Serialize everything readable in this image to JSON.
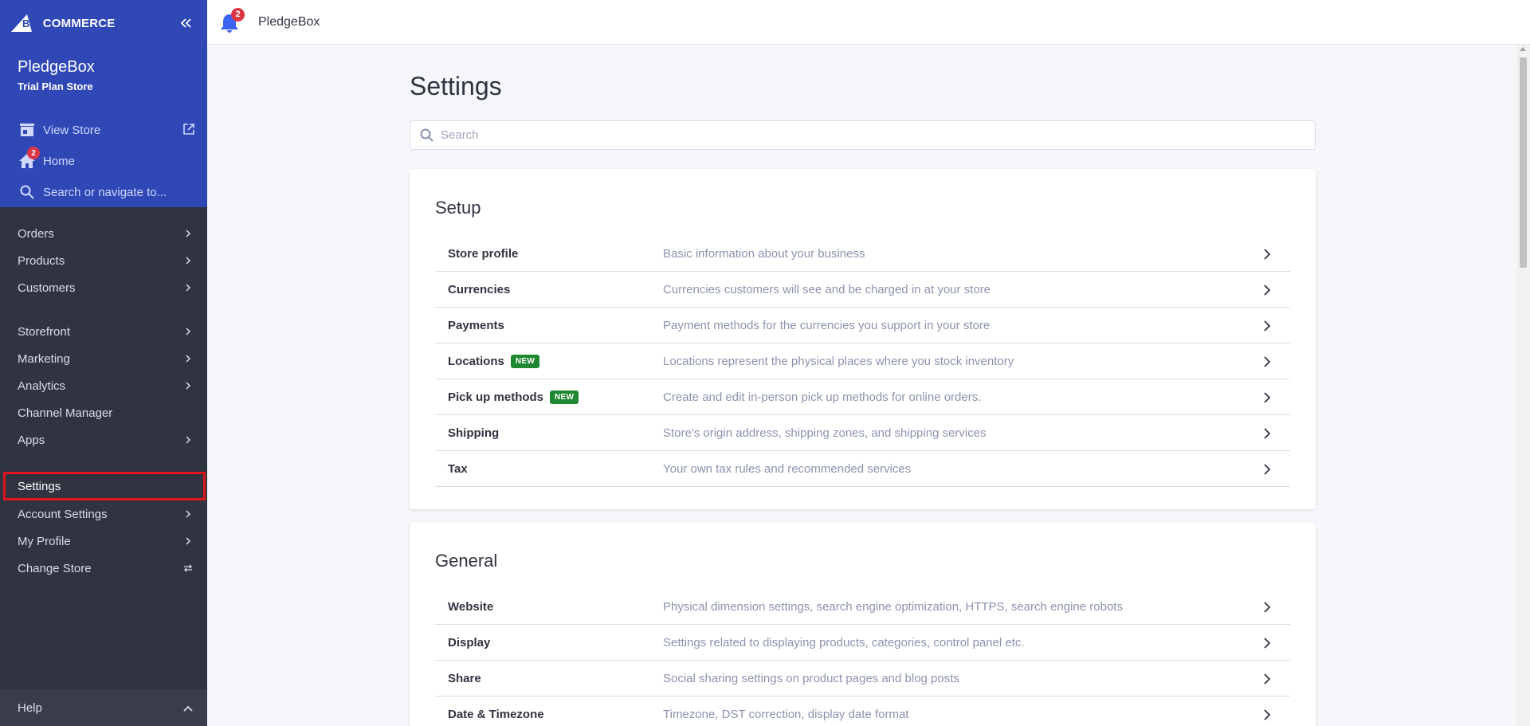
{
  "brand": {
    "logo_prefix": "BIG",
    "logo_suffix": "COMMERCE"
  },
  "store": {
    "name": "PledgeBox",
    "plan": "Trial Plan Store"
  },
  "sidebar_links": {
    "view_store": "View Store",
    "home": "Home",
    "home_badge": "2",
    "search": "Search or navigate to..."
  },
  "nav_group1": [
    {
      "label": "Orders",
      "chevron": true
    },
    {
      "label": "Products",
      "chevron": true
    },
    {
      "label": "Customers",
      "chevron": true
    }
  ],
  "nav_group2": [
    {
      "label": "Storefront",
      "chevron": true
    },
    {
      "label": "Marketing",
      "chevron": true
    },
    {
      "label": "Analytics",
      "chevron": true
    },
    {
      "label": "Channel Manager",
      "chevron": false
    },
    {
      "label": "Apps",
      "chevron": true
    }
  ],
  "nav_group3": [
    {
      "label": "Settings",
      "chevron": false,
      "active": true
    },
    {
      "label": "Account Settings",
      "chevron": true
    },
    {
      "label": "My Profile",
      "chevron": true
    },
    {
      "label": "Change Store",
      "swap": true
    }
  ],
  "help": {
    "label": "Help"
  },
  "topbar": {
    "title": "PledgeBox",
    "bell_badge": "2"
  },
  "page": {
    "title": "Settings",
    "search_placeholder": "Search"
  },
  "sections": {
    "setup": {
      "title": "Setup",
      "rows": [
        {
          "name": "Store profile",
          "desc": "Basic information about your business"
        },
        {
          "name": "Currencies",
          "desc": "Currencies customers will see and be charged in at your store"
        },
        {
          "name": "Payments",
          "desc": "Payment methods for the currencies you support in your store"
        },
        {
          "name": "Locations",
          "desc": "Locations represent the physical places where you stock inventory",
          "badge": "NEW"
        },
        {
          "name": "Pick up methods",
          "desc": "Create and edit in-person pick up methods for online orders.",
          "badge": "NEW"
        },
        {
          "name": "Shipping",
          "desc": "Store's origin address, shipping zones, and shipping services"
        },
        {
          "name": "Tax",
          "desc": "Your own tax rules and recommended services"
        }
      ]
    },
    "general": {
      "title": "General",
      "rows": [
        {
          "name": "Website",
          "desc": "Physical dimension settings, search engine optimization, HTTPS, search engine robots"
        },
        {
          "name": "Display",
          "desc": "Settings related to displaying products, categories, control panel etc."
        },
        {
          "name": "Share",
          "desc": "Social sharing settings on product pages and blog posts"
        },
        {
          "name": "Date & Timezone",
          "desc": "Timezone, DST correction, display date format"
        }
      ]
    }
  },
  "colors": {
    "sidebar_top": "#2f48b6",
    "sidebar": "#303340",
    "badge_red": "#db3643",
    "new_badge": "#208831",
    "active_outline": "#e0161c"
  }
}
